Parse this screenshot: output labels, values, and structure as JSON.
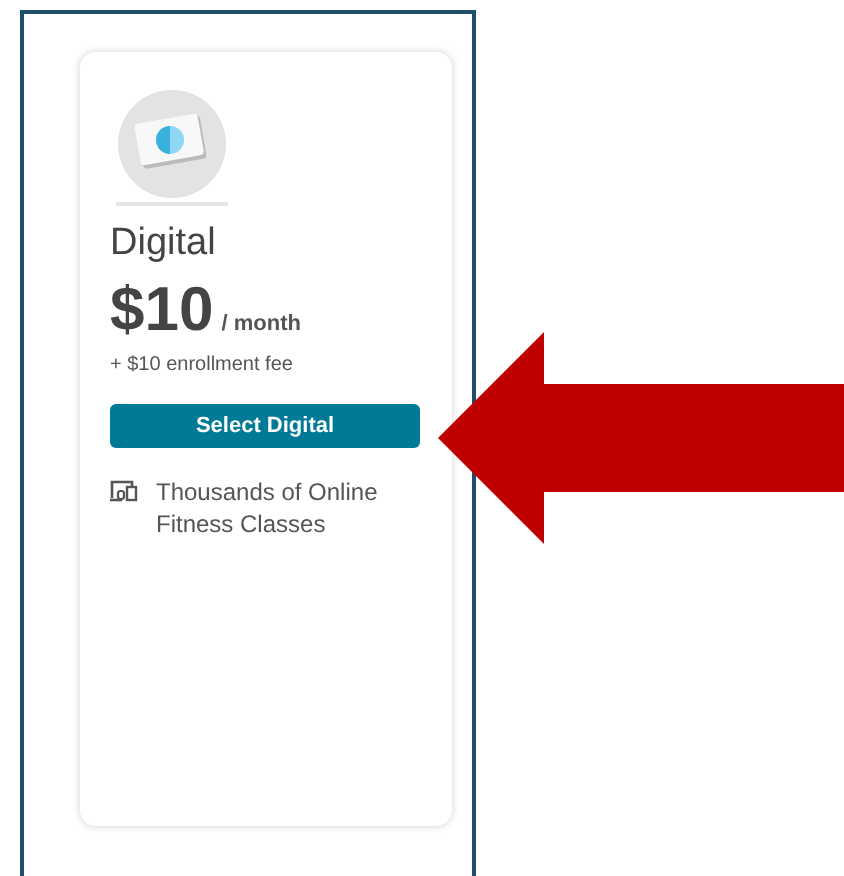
{
  "plan": {
    "name": "Digital",
    "price": "$10",
    "period": "/ month",
    "fee": "+ $10 enrollment fee",
    "button": "Select Digital",
    "features": [
      {
        "text": "Thousands of Online Fitness Classes"
      }
    ]
  }
}
